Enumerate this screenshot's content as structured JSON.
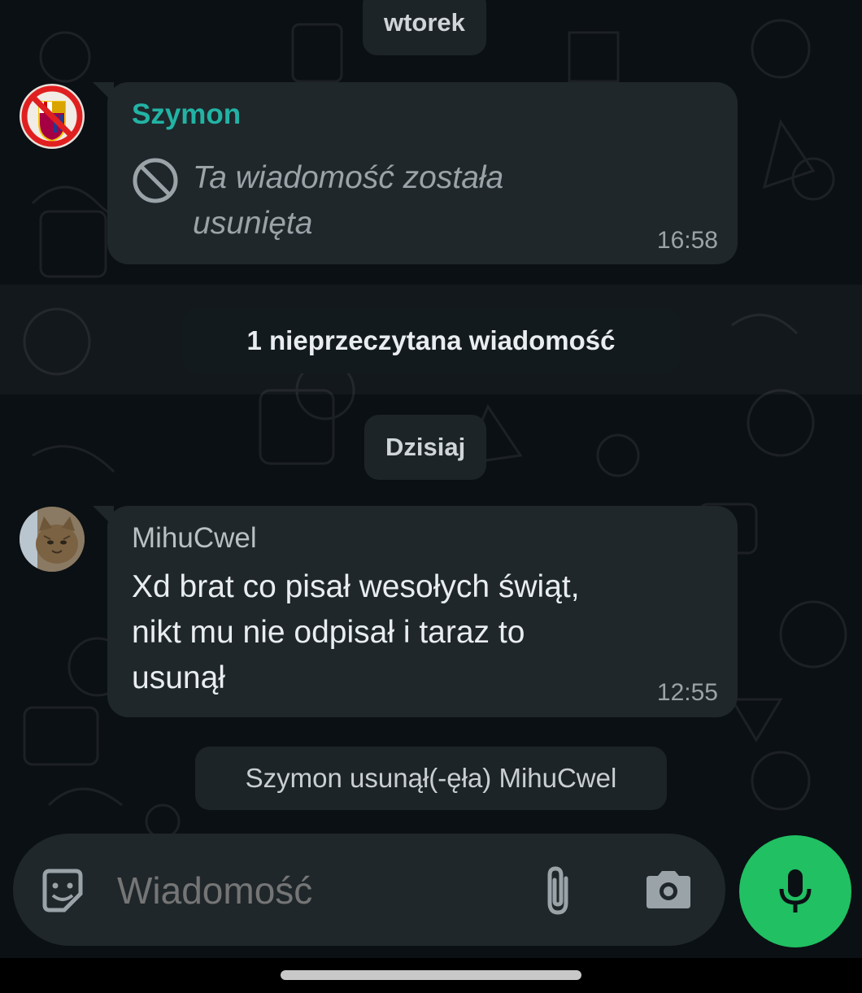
{
  "chat": {
    "date_dividers": {
      "first": "wtorek",
      "second": "Dzisiaj"
    },
    "unread_banner": "1 nieprzeczytana wiadomość",
    "messages": [
      {
        "sender": "Szymon",
        "sender_color": "#22b3a4",
        "avatar_icon": "barcelona-crest-prohibited-icon",
        "deleted_icon": "prohibited-icon",
        "text_line1": "Ta wiadomość została",
        "text_line2": "usunięta",
        "time": "16:58"
      },
      {
        "sender": "MihuCwel",
        "sender_color": "#b9bfc3",
        "avatar_icon": "cat-photo-avatar",
        "text_line1": "Xd brat co pisał wesołych świąt,",
        "text_line2": "nikt mu nie odpisał i taraz to",
        "text_line3": "usunął",
        "time": "12:55"
      }
    ],
    "system_notice": "Szymon usunął(-ęła) MihuCwel"
  },
  "composer": {
    "placeholder": "Wiadomość",
    "emoji_icon": "sticker-smiley-icon",
    "attach_icon": "paperclip-icon",
    "camera_icon": "camera-icon",
    "mic_icon": "microphone-icon",
    "mic_color": "#21c063"
  }
}
